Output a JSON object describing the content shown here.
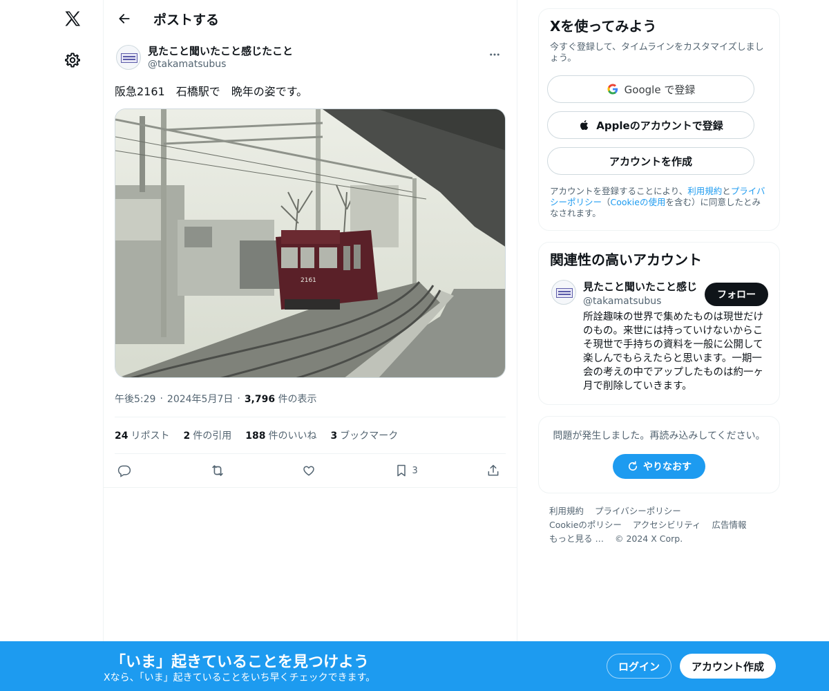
{
  "nav": {
    "logo_icon": "x-logo-icon",
    "settings_icon": "gear-icon"
  },
  "header": {
    "title": "ポストする"
  },
  "post": {
    "author_name": "見たこと聞いたこと感じたこと",
    "author_handle": "@takamatsubus",
    "text": "阪急2161　石橋駅で　晩年の姿です。",
    "time": "午後5:29",
    "date": "2024年5月7日",
    "views_count": "3,796",
    "views_label": "件の表示",
    "stats": [
      {
        "count": "24",
        "label": "リポスト"
      },
      {
        "count": "2",
        "label": "件の引用"
      },
      {
        "count": "188",
        "label": "件のいいね"
      },
      {
        "count": "3",
        "label": "ブックマーク"
      }
    ],
    "bookmark_count": "3",
    "photo_train_number": "2161"
  },
  "signup_card": {
    "title": "Xを使ってみよう",
    "subtitle": "今すぐ登録して、タイムラインをカスタマイズしましょう。",
    "google_label": "Google で登録",
    "apple_label": "Appleのアカウントで登録",
    "create_label": "アカウントを作成",
    "legal_prefix": "アカウントを登録することにより、",
    "legal_terms": "利用規約",
    "legal_and": "と",
    "legal_privacy": "プライバシーポリシー",
    "legal_paren_open": "（",
    "legal_cookie": "Cookieの使用",
    "legal_suffix": "を含む）に同意したとみなされます。"
  },
  "related_card": {
    "title": "関連性の高いアカウント",
    "name": "見たこと聞いたこと感じ",
    "handle": "@takamatsubus",
    "follow_label": "フォロー",
    "bio": "所詮趣味の世界で集めたものは現世だけのもの。来世には持っていけないからこそ現世で手持ちの資料を一般に公開して楽しんでもらえたらと思います。一期一会の考えの中でアップしたものは約一ヶ月で削除していきます。"
  },
  "error_card": {
    "message": "問題が発生しました。再読み込みしてください。",
    "retry_label": "やりなおす"
  },
  "footer": {
    "links_row1": [
      "利用規約",
      "プライバシーポリシー"
    ],
    "links_row2": [
      "Cookieのポリシー",
      "アクセシビリティ",
      "広告情報"
    ],
    "more": "もっと見る …",
    "copyright": "© 2024 X Corp."
  },
  "bottom_bar": {
    "title": "「いま」起きていることを見つけよう",
    "subtitle": "Xなら、「いま」起きていることをいち早くチェックできます。",
    "login_label": "ログイン",
    "signup_label": "アカウント作成"
  }
}
